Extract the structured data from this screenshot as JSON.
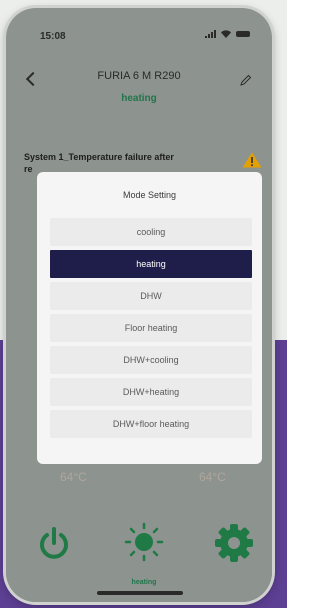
{
  "status": {
    "time": "15:08"
  },
  "header": {
    "title": "FURIA 6 M R290",
    "mode": "heating"
  },
  "alert": {
    "message": "System 1_Temperature failure after",
    "message_cont": "re"
  },
  "temperatures": {
    "left": "64°C",
    "right": "64°C"
  },
  "bottom": {
    "mode_label": "heating"
  },
  "dialog": {
    "title": "Mode Setting",
    "options": [
      "cooling",
      "heating",
      "DHW",
      "Floor heating",
      "DHW+cooling",
      "DHW+heating",
      "DHW+floor heating"
    ],
    "selected": "heating"
  },
  "colors": {
    "accent_green": "#20754a",
    "selected": "#1f1e4a",
    "purple_bg": "#5d3f93",
    "warning": "#e4a000"
  }
}
